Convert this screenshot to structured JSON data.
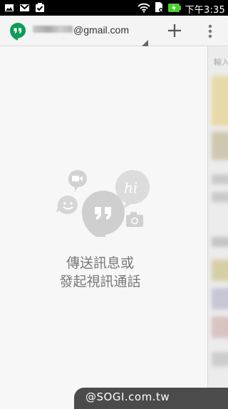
{
  "status_bar": {
    "time": "下午3:35",
    "icons": [
      "gallery-icon",
      "gmail-icon",
      "task-icon",
      "wifi-icon",
      "sim-icon",
      "battery-charging-icon"
    ]
  },
  "app_bar": {
    "account_email": "@gmail.com",
    "add_icon": "plus-icon",
    "menu_icon": "overflow-menu-icon"
  },
  "empty_state": {
    "line1": "傳送訊息或",
    "line2": "發起視訊通話",
    "bubble_text": "hi"
  },
  "side_panel": {
    "input_hint": "輸入"
  },
  "watermark": {
    "text": "@SOGI.com.tw"
  },
  "colors": {
    "hangouts_green": "#0f9d58",
    "bubble_gray": "#d6d6d6",
    "empty_text": "#777777"
  }
}
